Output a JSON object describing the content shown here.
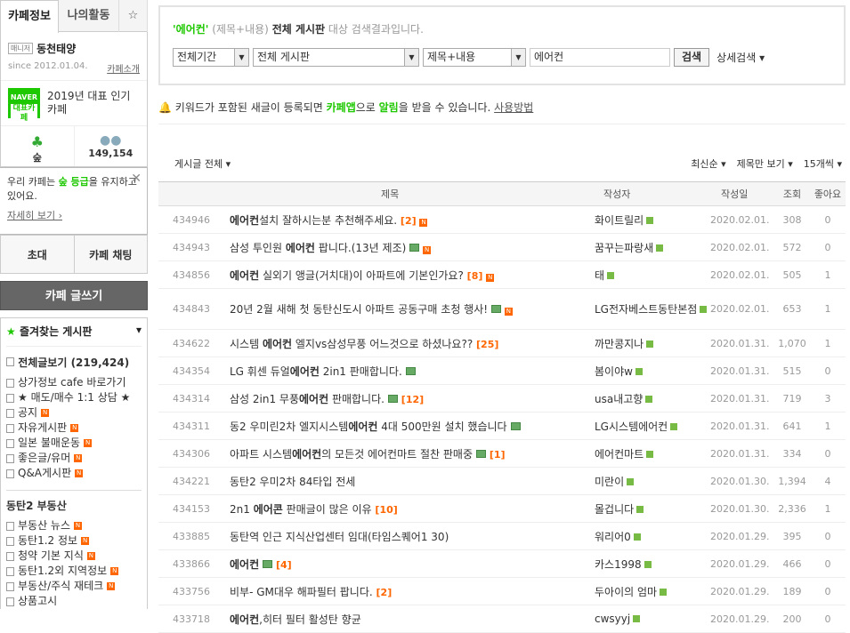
{
  "tabs": {
    "cafe_info": "카페정보",
    "my_activity": "나의활동",
    "star": "☆"
  },
  "cafe": {
    "manager": "매니저",
    "name": "동천태양",
    "since": "since 2012.01.04.",
    "intro": "카페소개"
  },
  "naver": {
    "line1": "NAVER",
    "line2": "대표카페",
    "text": "2019년 대표 인기카페"
  },
  "stats": {
    "level": "숲",
    "members": "149,154"
  },
  "tip": {
    "text1": "우리 카페는 ",
    "grade": "숲 등급",
    "text2": "을 유지하고 있어요.",
    "more": "자세히 보기 ›"
  },
  "actions": {
    "invite": "초대",
    "chat": "카페 채팅"
  },
  "write": "카페 글쓰기",
  "favorites": {
    "title": "즐겨찾는 게시판",
    "all": "전체글보기 (219,424)"
  },
  "menu": [
    "상가정보 cafe 바로가기",
    "★ 매도/매수 1:1 상담 ★",
    "공지",
    "자유게시판",
    "일본 불매운동",
    "좋은글/유머",
    "Q&A게시판"
  ],
  "section2": {
    "title": "동탄2 부동산",
    "items": [
      "부동산 뉴스",
      "동탄1.2 정보",
      "청약 기본 지식",
      "동탄1.2외 지역정보",
      "부동산/주식 재테크",
      "상품고시"
    ]
  },
  "search": {
    "keyword": "'에어컨'",
    "desc1": " (제목+내용) ",
    "board": "전체 게시판",
    "desc2": " 대상 검색결과입니다.",
    "period": "전체기간",
    "board_sel": "전체 게시판",
    "field": "제목+내용",
    "query": "에어컨",
    "btn": "검색",
    "detail": "상세검색 ▾"
  },
  "notice": {
    "t1": "키워드가 포함된 새글이 등록되면 ",
    "app": "카페앱",
    "t2": "으로 ",
    "alarm": "알림",
    "t3": "을 받을 수 있습니다. ",
    "how": "사용방법"
  },
  "listh": {
    "all": "게시글 전체 ▾",
    "sort": "최신순 ▾",
    "view": "제목만 보기 ▾",
    "count": "15개씩 ▾"
  },
  "headers": {
    "title": "제목",
    "author": "작성자",
    "date": "작성일",
    "views": "조회",
    "likes": "좋아요"
  },
  "rows": [
    {
      "id": "434946",
      "pre": "",
      "kw": "에어컨",
      "post": "설치 잘하시는분 추천해주세요.",
      "cnt": "[2]",
      "author": "화이트릴리",
      "date": "2020.02.01.",
      "views": "308",
      "likes": "0"
    },
    {
      "id": "434943",
      "pre": "삼성 투인원 ",
      "kw": "에어컨",
      "post": " 팝니다.(13년 제조)",
      "cnt": "",
      "author": "꿈꾸는파랑새",
      "date": "2020.02.01.",
      "views": "572",
      "likes": "0"
    },
    {
      "id": "434856",
      "pre": "",
      "kw": "에어컨",
      "post": " 실외기 앵글(거치대)이 아파트에 기본인가요?",
      "cnt": "[8]",
      "author": "태",
      "date": "2020.02.01.",
      "views": "505",
      "likes": "1"
    },
    {
      "id": "434843",
      "pre": "20년 2월 새해 첫 동탄신도시 아파트 공동구매 초청 행사!",
      "kw": "",
      "post": "",
      "cnt": "",
      "author": "LG전자베스트동탄본점",
      "date": "2020.02.01.",
      "views": "653",
      "likes": "1"
    },
    {
      "id": "434622",
      "pre": "시스템 ",
      "kw": "에어컨",
      "post": " 엘지vs삼성무풍 어느것으로 하셨나요??",
      "cnt": "[25]",
      "author": "까만콩지나",
      "date": "2020.01.31.",
      "views": "1,070",
      "likes": "1"
    },
    {
      "id": "434354",
      "pre": "LG 휘센 듀얼",
      "kw": "에어컨",
      "post": " 2in1 판매합니다.",
      "cnt": "",
      "author": "봄이야w",
      "date": "2020.01.31.",
      "views": "515",
      "likes": "0"
    },
    {
      "id": "434314",
      "pre": "삼성 2in1 무풍",
      "kw": "에어컨",
      "post": " 판매합니다.",
      "cnt": "[12]",
      "author": "usa내고향",
      "date": "2020.01.31.",
      "views": "719",
      "likes": "3"
    },
    {
      "id": "434311",
      "pre": "동2 우미린2차 엘지시스템",
      "kw": "에어컨",
      "post": " 4대 500만원 설치 했습니다",
      "cnt": "",
      "author": "LG시스템에어컨",
      "date": "2020.01.31.",
      "views": "641",
      "likes": "1"
    },
    {
      "id": "434306",
      "pre": "아파트 시스템",
      "kw": "에어컨",
      "post": "의 모든것 에어컨마트 절찬 판매중",
      "cnt": "[1]",
      "author": "에어컨마트",
      "date": "2020.01.31.",
      "views": "334",
      "likes": "0"
    },
    {
      "id": "434221",
      "pre": "동탄2 우미2차 84타입 전세",
      "kw": "",
      "post": "",
      "cnt": "",
      "author": "미란이",
      "date": "2020.01.30.",
      "views": "1,394",
      "likes": "4"
    },
    {
      "id": "434153",
      "pre": "2n1 ",
      "kw": "에어콘",
      "post": " 판매글이 많은 이유",
      "cnt": "[10]",
      "author": "몰겁니다",
      "date": "2020.01.30.",
      "views": "2,336",
      "likes": "1"
    },
    {
      "id": "433885",
      "pre": "동탄역 인근 지식산업센터 임대(타임스퀘어1 30)",
      "kw": "",
      "post": "",
      "cnt": "",
      "author": "워리어0",
      "date": "2020.01.29.",
      "views": "395",
      "likes": "0"
    },
    {
      "id": "433866",
      "pre": "",
      "kw": "에어컨",
      "post": "",
      "cnt": "[4]",
      "author": "카스1998",
      "date": "2020.01.29.",
      "views": "466",
      "likes": "0"
    },
    {
      "id": "433756",
      "pre": "비부- GM대우 해파필터 팝니다.",
      "kw": "",
      "post": "",
      "cnt": "[2]",
      "author": "두아이의 엄마",
      "date": "2020.01.29.",
      "views": "189",
      "likes": "0"
    },
    {
      "id": "433718",
      "pre": "",
      "kw": "에어컨",
      "post": ",히터 필터 활성탄 향균",
      "cnt": "",
      "author": "cwsyyj",
      "date": "2020.01.29.",
      "views": "200",
      "likes": "0"
    }
  ]
}
